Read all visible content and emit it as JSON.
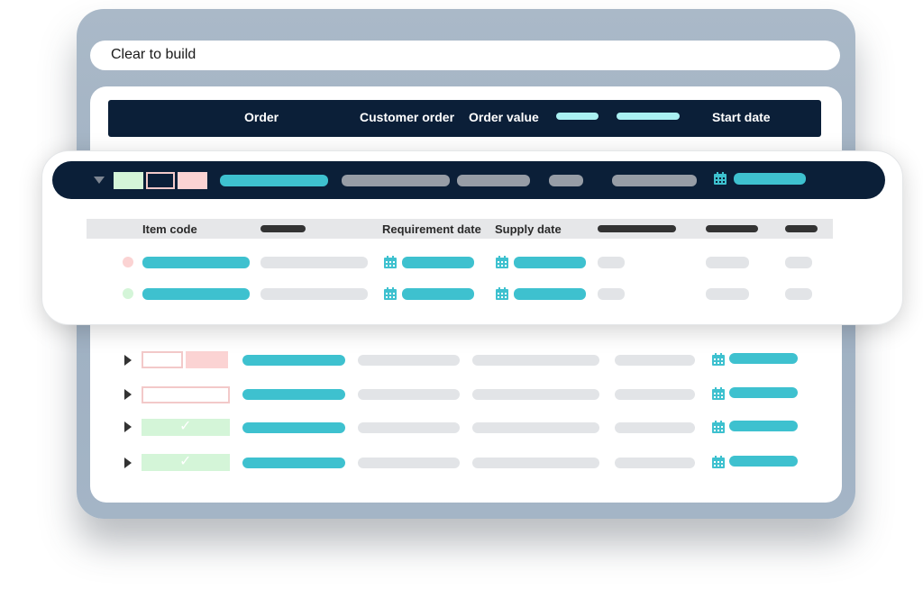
{
  "window": {
    "title": "Clear to build"
  },
  "order_table": {
    "columns": [
      "Order",
      "Customer order",
      "Order value",
      "Start date"
    ]
  },
  "expanded_order": {
    "columns": [
      "Item code",
      "Requirement date",
      "Supply date"
    ],
    "items": [
      {
        "status_color": "#fbd3d3"
      },
      {
        "status_color": "#d4f5d8"
      }
    ]
  },
  "orders": [
    {
      "status": "partial"
    },
    {
      "status": "empty"
    },
    {
      "status": "clear",
      "check": "✓"
    },
    {
      "status": "clear",
      "check": "✓"
    }
  ],
  "colors": {
    "navy": "#0b1f38",
    "teal": "#3ec1cf",
    "pink": "#fbd3d3",
    "green": "#d4f5d8"
  },
  "icons": {
    "calendar": "calendar-icon",
    "expand": "caret-right-icon",
    "collapse": "caret-down-icon"
  }
}
